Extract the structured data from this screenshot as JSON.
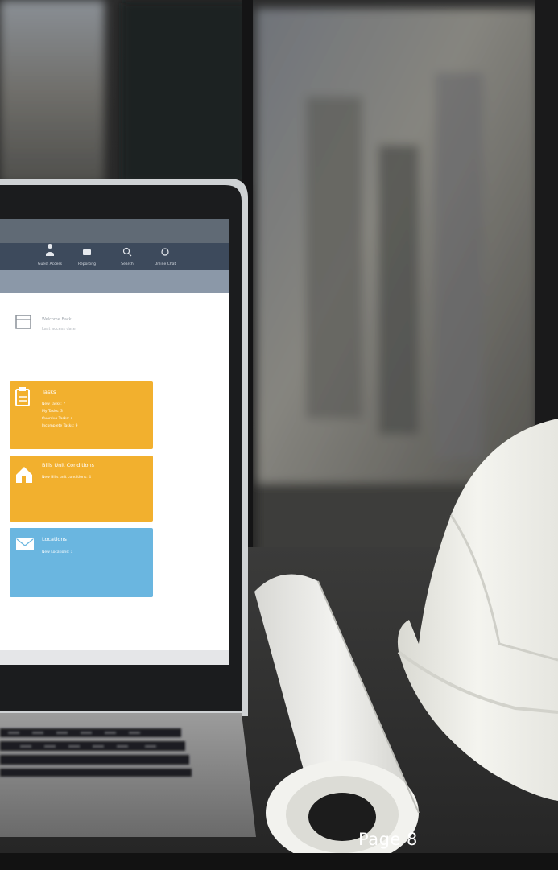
{
  "page": {
    "label": "Page 8"
  },
  "screen": {
    "toolbar_items": [
      {
        "label": "Guest Access",
        "icon": "person-icon"
      },
      {
        "label": "Reporting",
        "icon": "folder-icon"
      },
      {
        "label": "Search",
        "icon": "search-icon"
      },
      {
        "label": "Online Chat",
        "icon": "chat-icon"
      }
    ],
    "header_lines": [
      "Welcome Back",
      "Last access date"
    ],
    "tiles": [
      {
        "title": "Tasks",
        "lines": [
          "New Tasks: 7",
          "My Tasks: 3",
          "Overdue Tasks: 4",
          "Incomplete Tasks: 9"
        ],
        "color": "#f2b02e",
        "icon": "clipboard-icon"
      },
      {
        "title": "Bills Unit Conditions",
        "lines": [
          "New Bills unit conditions: 4"
        ],
        "color": "#f2b02e",
        "icon": "house-icon"
      },
      {
        "title": "Locations",
        "lines": [
          "New Locations: 1"
        ],
        "color": "#6ab6e0",
        "icon": "envelope-icon"
      }
    ]
  },
  "colors": {
    "toolbar": "#3d4a5c",
    "tile_orange": "#f2b02e",
    "tile_blue": "#6ab6e0",
    "helmet": "#efefe9"
  }
}
